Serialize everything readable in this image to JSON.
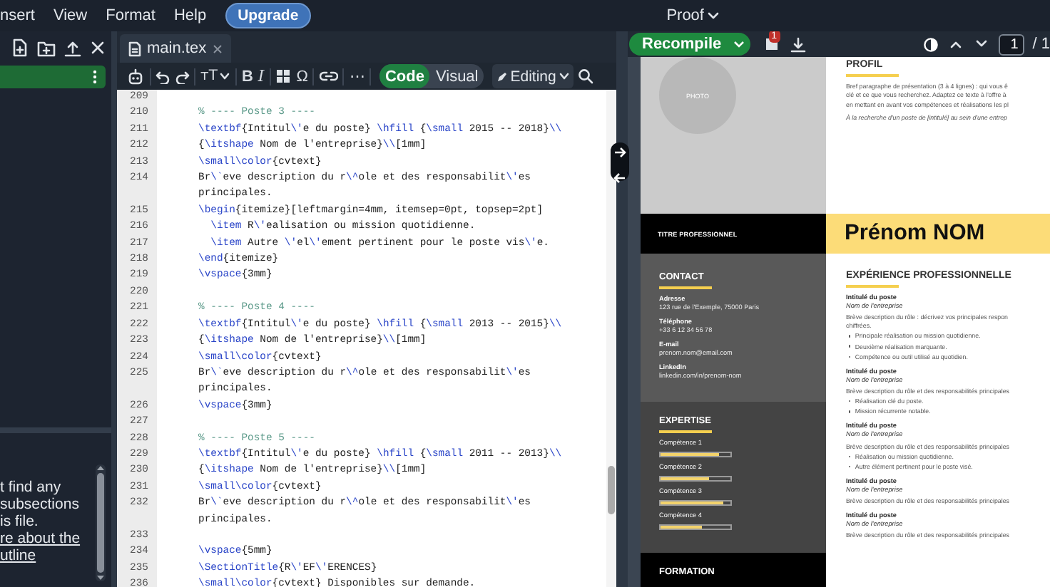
{
  "menu_bar": {
    "items": [
      "nsert",
      "View",
      "Format",
      "Help"
    ],
    "upgrade": "Upgrade",
    "proof": "Proof"
  },
  "file_tree": {
    "rows": [
      {
        "selected": true
      }
    ]
  },
  "outline": {
    "message_lines": [
      "t find any",
      "subsections",
      "is file."
    ],
    "link_lines": [
      "re about the",
      "utline"
    ]
  },
  "editor": {
    "tab": "main.tex",
    "toolbar": {
      "text_style": "ᴛT",
      "bold": "B",
      "italic": "I",
      "symbol": "Ω",
      "more": "⋯",
      "editing": "Editing"
    },
    "mode_toggle": [
      {
        "label": "Code",
        "selected": true
      },
      {
        "label": "Visual",
        "selected": false
      }
    ],
    "lines": [
      {
        "number": "209"
      },
      {
        "number": "210",
        "text": "% ---- Poste 3 ----"
      },
      {
        "number": "211",
        "text": "\\textbf{Intitul\\'e du poste} \\hfill {\\small 2015 -- 2018}\\\\"
      },
      {
        "number": "212",
        "text": "{\\itshape Nom de l'entreprise}\\\\[1mm]"
      },
      {
        "number": "213",
        "text": "\\small\\color{cvtext}"
      },
      {
        "number": "214",
        "text": "Br\\`eve description du r\\^ole et des responsabilit\\'es principales."
      },
      {
        "number": "215",
        "text": "\\begin{itemize}[leftmargin=4mm, itemsep=0pt, topsep=2pt]"
      },
      {
        "number": "216",
        "text": "  \\item R\\'ealisation ou mission quotidienne."
      },
      {
        "number": "217",
        "text": "  \\item Autre \\'el\\'ement pertinent pour le poste vis\\'e."
      },
      {
        "number": "218",
        "text": "\\end{itemize}"
      },
      {
        "number": "219",
        "text": "\\vspace{3mm}"
      },
      {
        "number": "220"
      },
      {
        "number": "221",
        "text": "% ---- Poste 4 ----"
      },
      {
        "number": "222",
        "text": "\\textbf{Intitul\\'e du poste} \\hfill {\\small 2013 -- 2015}\\\\"
      },
      {
        "number": "223",
        "text": "{\\itshape Nom de l'entreprise}\\\\[1mm]"
      },
      {
        "number": "224",
        "text": "\\small\\color{cvtext}"
      },
      {
        "number": "225",
        "text": "Br\\`eve description du r\\^ole et des responsabilit\\'es principales."
      },
      {
        "number": "226",
        "text": "\\vspace{3mm}"
      },
      {
        "number": "227"
      },
      {
        "number": "228",
        "text": "% ---- Poste 5 ----"
      },
      {
        "number": "229",
        "text": "\\textbf{Intitul\\'e du poste} \\hfill {\\small 2011 -- 2013}\\\\"
      },
      {
        "number": "230",
        "text": "{\\itshape Nom de l'entreprise}\\\\[1mm]"
      },
      {
        "number": "231",
        "text": "\\small\\color{cvtext}"
      },
      {
        "number": "232",
        "text": "Br\\`eve description du r\\^ole et des responsabilit\\'es principales."
      },
      {
        "number": "233"
      },
      {
        "number": "234",
        "text": "\\vspace{5mm}"
      },
      {
        "number": "235",
        "text": "\\SectionTitle{R\\'EF\\'ERENCES}"
      },
      {
        "number": "236",
        "text": "\\small\\color{cvtext} Disponibles sur demande."
      }
    ]
  },
  "preview": {
    "recompile": "Recompile",
    "error_count": "1",
    "page": "1",
    "page_total": "/ 1",
    "pdf": {
      "photo": "PHOTO",
      "job_title": "TITRE PROFESSIONNEL",
      "name": "Prénom NOM",
      "contact": {
        "heading": "CONTACT",
        "items": [
          {
            "label": "Adresse",
            "value": "123 rue de l'Exemple, 75000 Paris"
          },
          {
            "label": "Téléphone",
            "value": "+33 6 12 34 56 78"
          },
          {
            "label": "E-mail",
            "value": "prenom.nom@email.com"
          },
          {
            "label": "LinkedIn",
            "value": "linkedin.com/in/prenom-nom"
          }
        ]
      },
      "expertise": {
        "heading": "EXPERTISE",
        "skills": [
          {
            "name": "Compétence 1",
            "level": 0.84
          },
          {
            "name": "Compétence 2",
            "level": 0.7
          },
          {
            "name": "Compétence 3",
            "level": 0.9
          },
          {
            "name": "Compétence 4",
            "level": 0.6
          }
        ]
      },
      "formation": {
        "heading": "FORMATION"
      },
      "profile": {
        "heading": "PROFIL",
        "lines": [
          "Bref paragraphe de présentation (3 à 4 lignes) : qui vous ê",
          "clé et ce que vous recherchez.  Adaptez ce texte à l'offre à",
          "en mettant en avant vos compétences et réalisations les pl"
        ],
        "tagline": "À la recherche d'un poste de [intitulé] au sein d'une entrep"
      },
      "experience": {
        "heading": "EXPÉRIENCE PROFESSIONNELLE",
        "jobs": [
          {
            "title": "Intitulé du poste",
            "company": "Nom de l'entreprise",
            "description": [
              "Brève description du rôle : décrivez vos principales respon",
              "chiffrées."
            ],
            "bullets": [
              "Principale réalisation ou mission quotidienne.",
              "Deuxième réalisation marquante.",
              "Compétence ou outil utilisé au quotidien."
            ]
          },
          {
            "title": "Intitulé du poste",
            "company": "Nom de l'entreprise",
            "description": [
              "Brève description du rôle et des responsabilités principales"
            ],
            "bullets": [
              "Réalisation clé du poste.",
              "Mission récurrente notable."
            ]
          },
          {
            "title": "Intitulé du poste",
            "company": "Nom de l'entreprise",
            "description": [
              "Brève description du rôle et des responsabilités principales"
            ],
            "bullets": [
              "Réalisation ou mission quotidienne.",
              "Autre élément pertinent pour le poste visé."
            ]
          },
          {
            "title": "Intitulé du poste",
            "company": "Nom de l'entreprise",
            "description": [
              "Brève description du rôle et des responsabilités principales"
            ]
          },
          {
            "title": "Intitulé du poste",
            "company": "Nom de l'entreprise",
            "description": [
              "Brève description du rôle et des responsabilités principales"
            ]
          }
        ]
      }
    }
  }
}
